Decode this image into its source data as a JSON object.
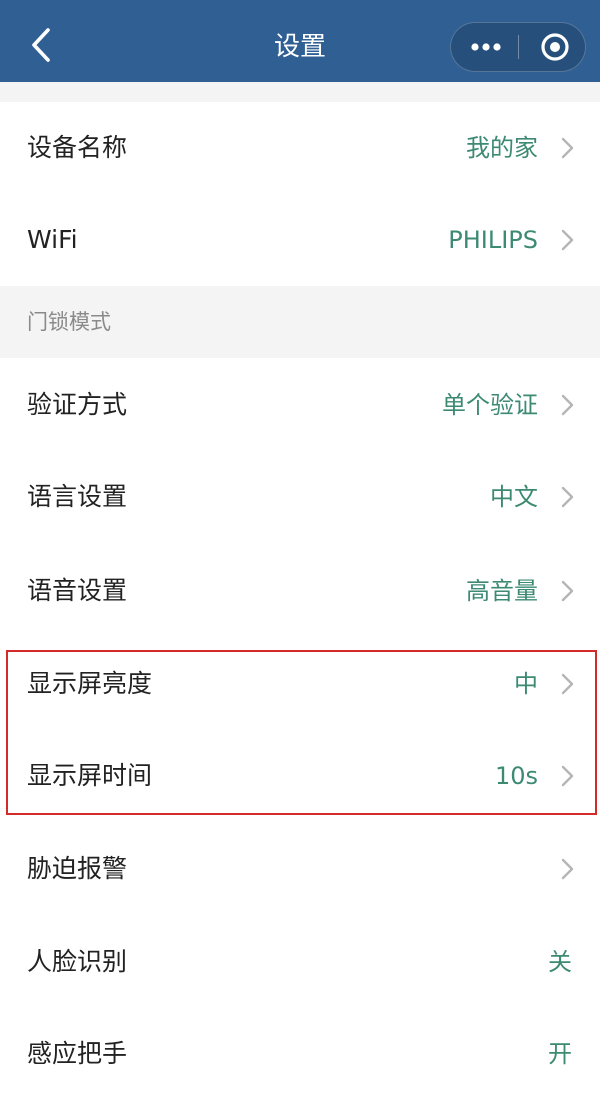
{
  "nav": {
    "title": "设置",
    "background_color": "#2f5f93",
    "back_icon": "chevron-left-icon",
    "more_icon": "more-dots-icon",
    "close_icon": "target-circle-icon"
  },
  "sections": [
    {
      "title": "",
      "items": [
        {
          "label": "设备名称",
          "value": "我的家",
          "chevron": true
        },
        {
          "label": "WiFi",
          "value": "PHILIPS",
          "chevron": true
        }
      ]
    },
    {
      "title": "门锁模式",
      "items": [
        {
          "label": "验证方式",
          "value": "单个验证",
          "chevron": true
        },
        {
          "label": "语言设置",
          "value": "中文",
          "chevron": true
        },
        {
          "label": "语音设置",
          "value": "高音量",
          "chevron": true
        },
        {
          "label": "显示屏亮度",
          "value": "中",
          "chevron": true
        },
        {
          "label": "显示屏时间",
          "value": "10s",
          "chevron": true
        },
        {
          "label": "胁迫报警",
          "value": "",
          "chevron": true
        },
        {
          "label": "人脸识别",
          "value": "关",
          "chevron": false
        },
        {
          "label": "感应把手",
          "value": "开",
          "chevron": false
        }
      ]
    }
  ],
  "colors": {
    "value_text": "#3d8a73",
    "label_text": "#222222",
    "section_label": "#8a8a8a",
    "highlight_border": "#d42a2a",
    "gap_background": "#f4f4f4"
  }
}
